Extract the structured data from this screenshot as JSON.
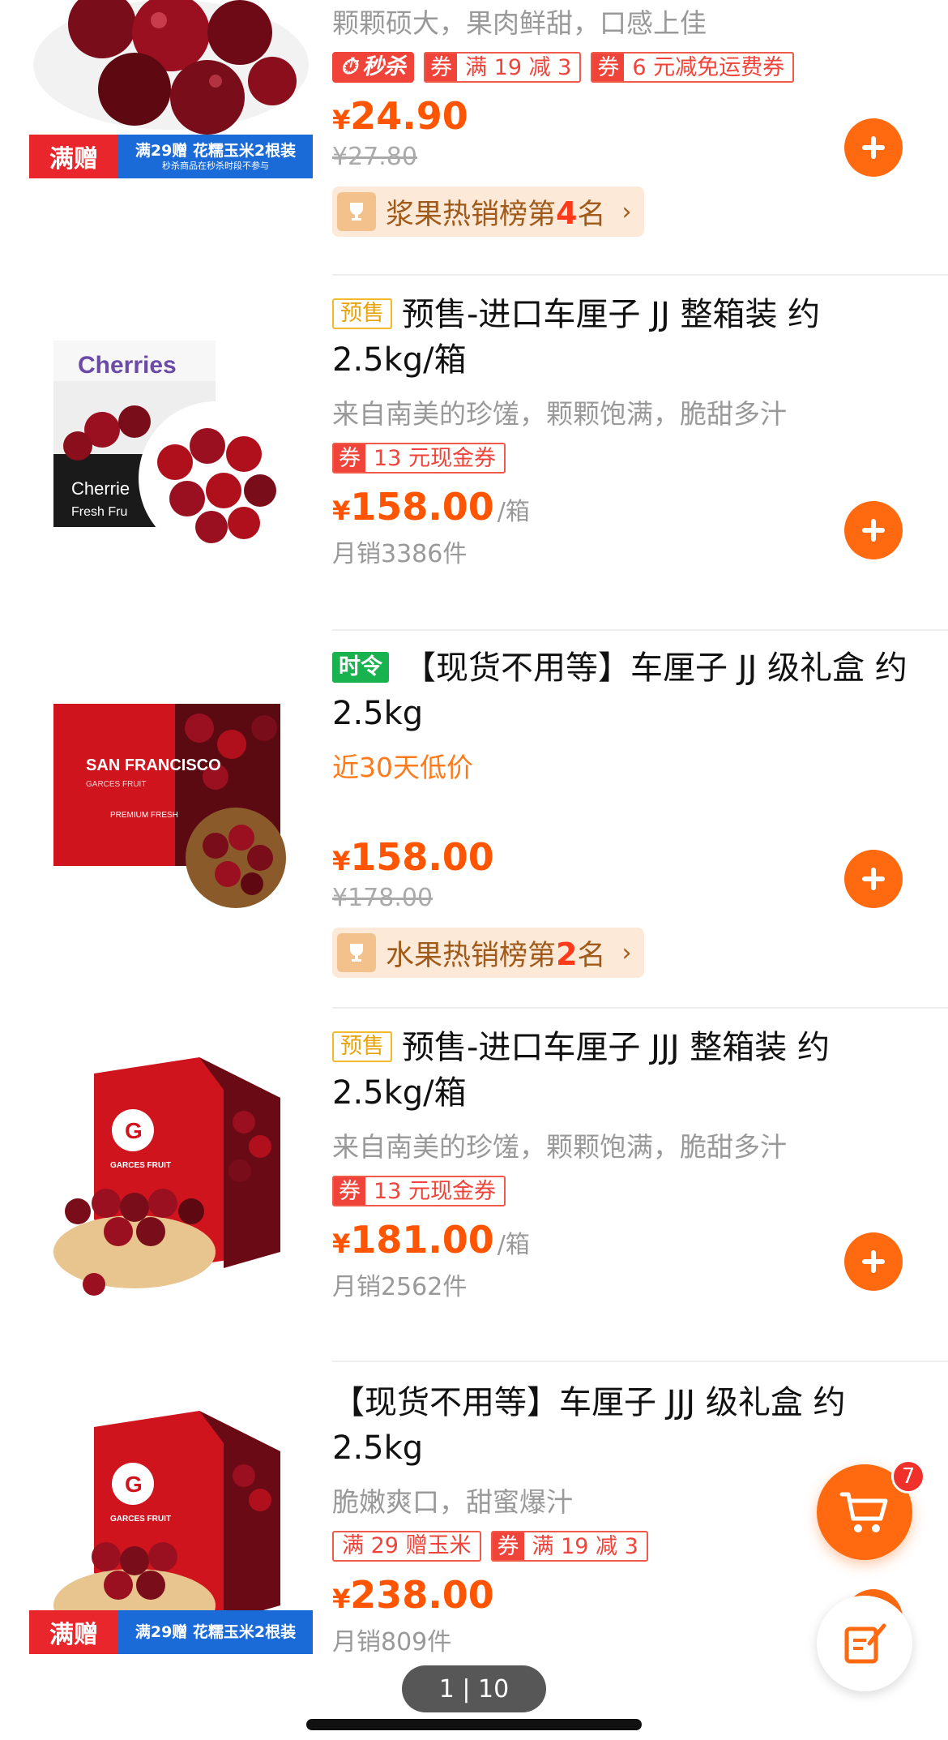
{
  "products": [
    {
      "subtitle": "颗颗硕大，果肉鲜甜，口感上佳",
      "tags": {
        "seckill": "秒杀",
        "coupon1_q": "券",
        "coupon1": "满 19 减 3",
        "coupon2_q": "券",
        "coupon2": "6 元减免运费券"
      },
      "price_currency": "¥",
      "price": "24.90",
      "original_price": "¥27.80",
      "rank": {
        "prefix": "浆果热销榜第",
        "num": "4",
        "suffix": "名"
      },
      "promo_left": "满赠",
      "promo_main": "满29赠 花糯玉米2根装",
      "promo_sub": "秒杀商品在秒杀时段不参与"
    },
    {
      "badge": "预售",
      "title": "预售-进口车厘子 JJ 整箱装 约 2.5kg/箱",
      "subtitle": "来自南美的珍馐，颗颗饱满，脆甜多汁",
      "coupon_q": "券",
      "coupon": "13 元现金券",
      "price_currency": "¥",
      "price": "158.00",
      "unit": "/箱",
      "sales": "月销3386件",
      "image_label": "Cherries",
      "image_label2": "Cherrie",
      "image_label3": "Fresh Fru"
    },
    {
      "badge": "时令",
      "title": "【现货不用等】车厘子 JJ 级礼盒 约 2.5kg",
      "lowprice": "近30天低价",
      "price_currency": "¥",
      "price": "158.00",
      "original_price": "¥178.00",
      "rank": {
        "prefix": "水果热销榜第",
        "num": "2",
        "suffix": "名"
      },
      "image_label": "SAN FRANCISCO",
      "image_label2": "GARCES FRUIT",
      "image_label3": "PREMIUM FRESH"
    },
    {
      "badge": "预售",
      "title": "预售-进口车厘子 JJJ 整箱装 约 2.5kg/箱",
      "subtitle": "来自南美的珍馐，颗颗饱满，脆甜多汁",
      "coupon_q": "券",
      "coupon": "13 元现金券",
      "price_currency": "¥",
      "price": "181.00",
      "unit": "/箱",
      "sales": "月销2562件",
      "image_label": "GARCES FRUIT"
    },
    {
      "title": "【现货不用等】车厘子 JJJ 级礼盒 约 2.5kg",
      "subtitle": "脆嫩爽口，甜蜜爆汁",
      "tag_plain": "满 29 赠玉米",
      "coupon_q": "券",
      "coupon": "满 19 减 3",
      "price_currency": "¥",
      "price": "238.00",
      "sales": "月销809件",
      "promo_left": "满赠",
      "promo_main": "满29赠 花糯玉米2根装",
      "image_label": "GARCES FRUIT"
    }
  ],
  "cart": {
    "badge_count": "7"
  },
  "pager": {
    "text": "1 | 10"
  },
  "colors": {
    "accent": "#ff6a10",
    "price": "#ff5500",
    "coupon": "#f0443a"
  }
}
